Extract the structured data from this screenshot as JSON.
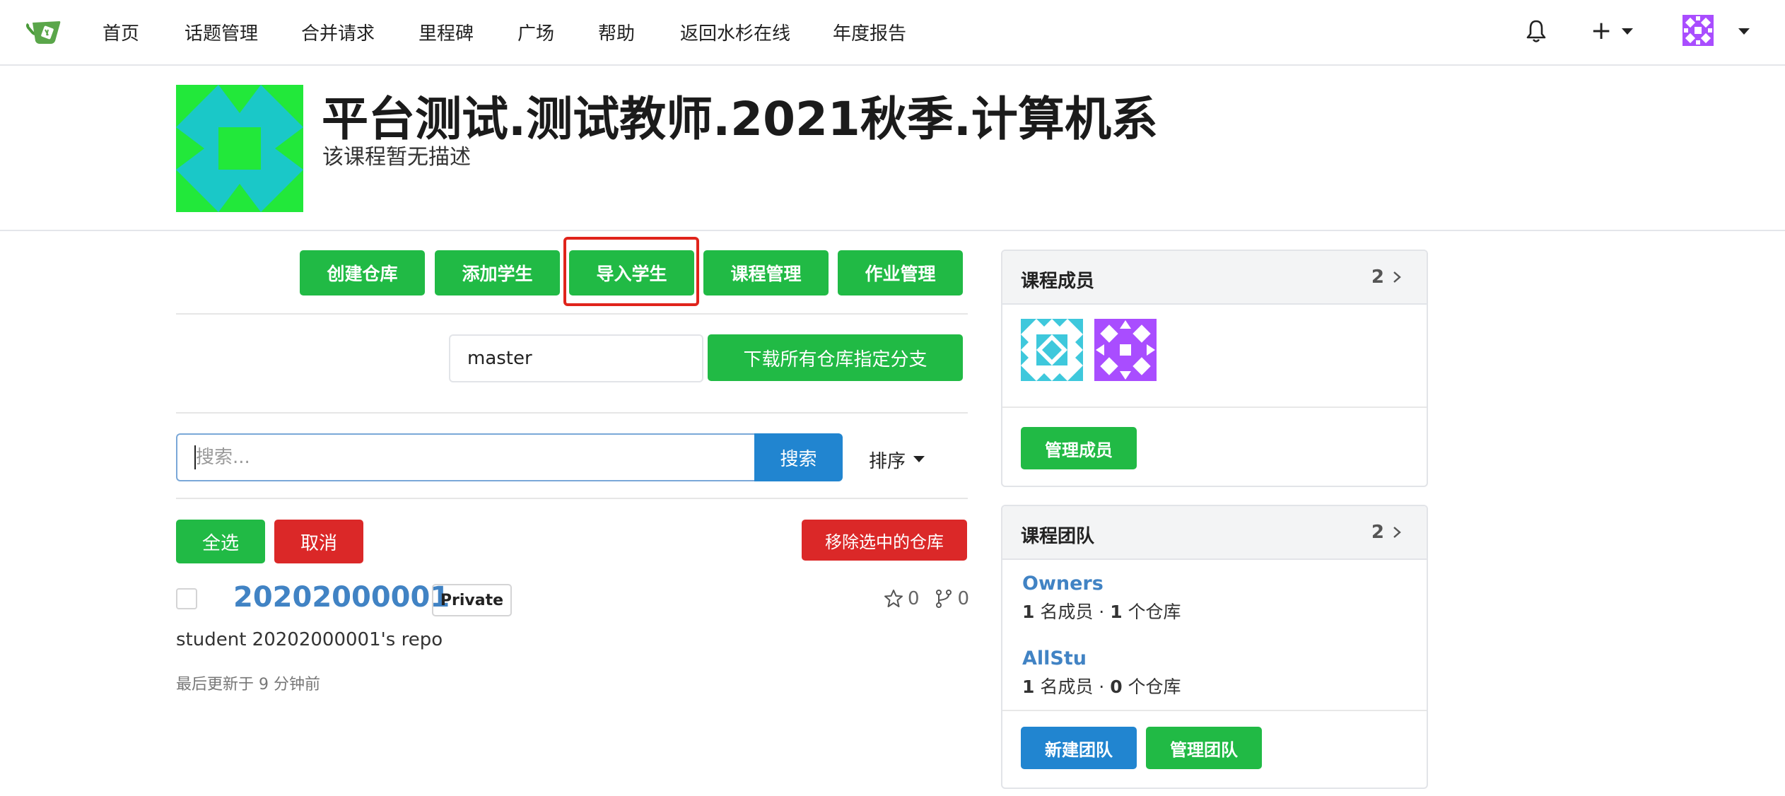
{
  "nav": {
    "items": [
      "首页",
      "话题管理",
      "合并请求",
      "里程碑",
      "广场",
      "帮助",
      "返回水杉在线",
      "年度报告"
    ],
    "plus": "+"
  },
  "course": {
    "title": "平台测试.测试教师.2021秋季.计算机系",
    "description": "该课程暂无描述"
  },
  "actions": {
    "create_repo": "创建仓库",
    "add_student": "添加学生",
    "import_students": "导入学生",
    "course_manage": "课程管理",
    "homework_manage": "作业管理"
  },
  "branch": {
    "value": "master",
    "download_label": "下载所有仓库指定分支"
  },
  "search": {
    "placeholder": "搜索...",
    "button": "搜索",
    "sort": "排序"
  },
  "selection": {
    "select_all": "全选",
    "cancel": "取消",
    "remove_selected": "移除选中的仓库"
  },
  "repo": {
    "name": "20202000001",
    "visibility": "Private",
    "stars": "0",
    "forks": "0",
    "description": "student 20202000001's repo",
    "updated": "最后更新于 9 分钟前"
  },
  "members_card": {
    "title": "课程成员",
    "count": "2",
    "manage": "管理成员"
  },
  "teams_card": {
    "title": "课程团队",
    "count": "2",
    "teams": [
      {
        "name": "Owners",
        "members": "1",
        "members_suffix": " 名成员 · ",
        "repos": "1",
        "repos_suffix": " 个仓库"
      },
      {
        "name": "AllStu",
        "members": "1",
        "members_suffix": " 名成员 · ",
        "repos": "0",
        "repos_suffix": " 个仓库"
      }
    ],
    "new_team": "新建团队",
    "manage_team": "管理团队"
  },
  "colors": {
    "green": "#21ba45",
    "red": "#db2828",
    "blue": "#2185d0",
    "link": "#4183c4",
    "highlight": "#e0241b"
  }
}
